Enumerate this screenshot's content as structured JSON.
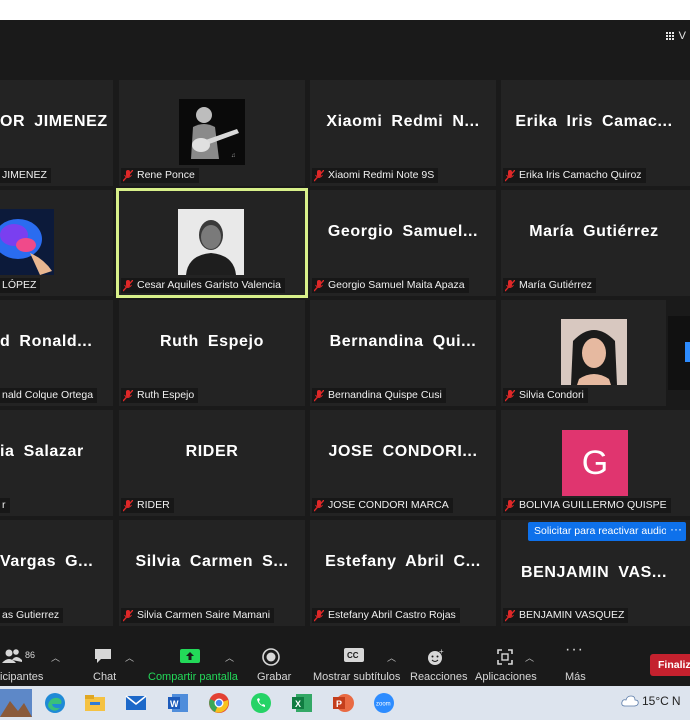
{
  "header": {
    "view_label": "V"
  },
  "tiles": [
    {
      "big": "OR JIMENEZ",
      "label": "JIMENEZ"
    },
    {
      "big": "",
      "label": "Rene Ponce"
    },
    {
      "big": "Xiaomi  Redmi  N...",
      "label": "Xiaomi Redmi Note 9S"
    },
    {
      "big": "Erika  Iris  Camac...",
      "label": "Erika Iris Camacho Quiroz"
    },
    {
      "big": "",
      "label": "LÓPEZ"
    },
    {
      "big": "",
      "label": "Cesar Aquiles Garisto Valencia"
    },
    {
      "big": "Georgio  Samuel...",
      "label": "Georgio Samuel Maita Apaza"
    },
    {
      "big": "María  Gutiérrez",
      "label": "María Gutiérrez"
    },
    {
      "big": "d  Ronald...",
      "label": "nald Colque Ortega"
    },
    {
      "big": "Ruth  Espejo",
      "label": "Ruth Espejo"
    },
    {
      "big": "Bernandina  Qui...",
      "label": "Bernandina Quispe Cusi"
    },
    {
      "big": "",
      "label": "Silvia Condori"
    },
    {
      "big": "ia  Salazar",
      "label": "r"
    },
    {
      "big": "RIDER",
      "label": "RIDER"
    },
    {
      "big": "JOSE  CONDORI...",
      "label": "JOSE CONDORI MARCA"
    },
    {
      "big": "",
      "label": "BOLIVIA GUILLERMO QUISPE"
    },
    {
      "big": "Vargas  G...",
      "label": "as Gutierrez"
    },
    {
      "big": "Silvia  Carmen  S...",
      "label": "Silvia Carmen Saire Mamani"
    },
    {
      "big": "Estefany  Abril  C...",
      "label": "Estefany Abril Castro Rojas"
    },
    {
      "big": "BENJAMIN  VAS...",
      "label": "BENJAMIN VASQUEZ"
    }
  ],
  "avatar_letter": "G",
  "request_audio_label": "Solicitar para reactivar audio",
  "more_label": "···",
  "toolbar": {
    "participants_label": "icipantes",
    "participants_count": "86",
    "chat_label": "Chat",
    "share_label": "Compartir pantalla",
    "record_label": "Grabar",
    "subtitles_label": "Mostrar subtítulos",
    "reactions_label": "Reacciones",
    "apps_label": "Aplicaciones",
    "more_label": "Más",
    "end_label": "Finaliz"
  },
  "weather": {
    "temp": "15°C",
    "extra": "N"
  },
  "colors": {
    "accent_blue": "#0e71eb",
    "share_green": "#23d959",
    "end_red": "#c4212e",
    "active_speaker": "#d8f08a",
    "muted_red": "#e02828",
    "avatar_pink": "#e0356f"
  }
}
